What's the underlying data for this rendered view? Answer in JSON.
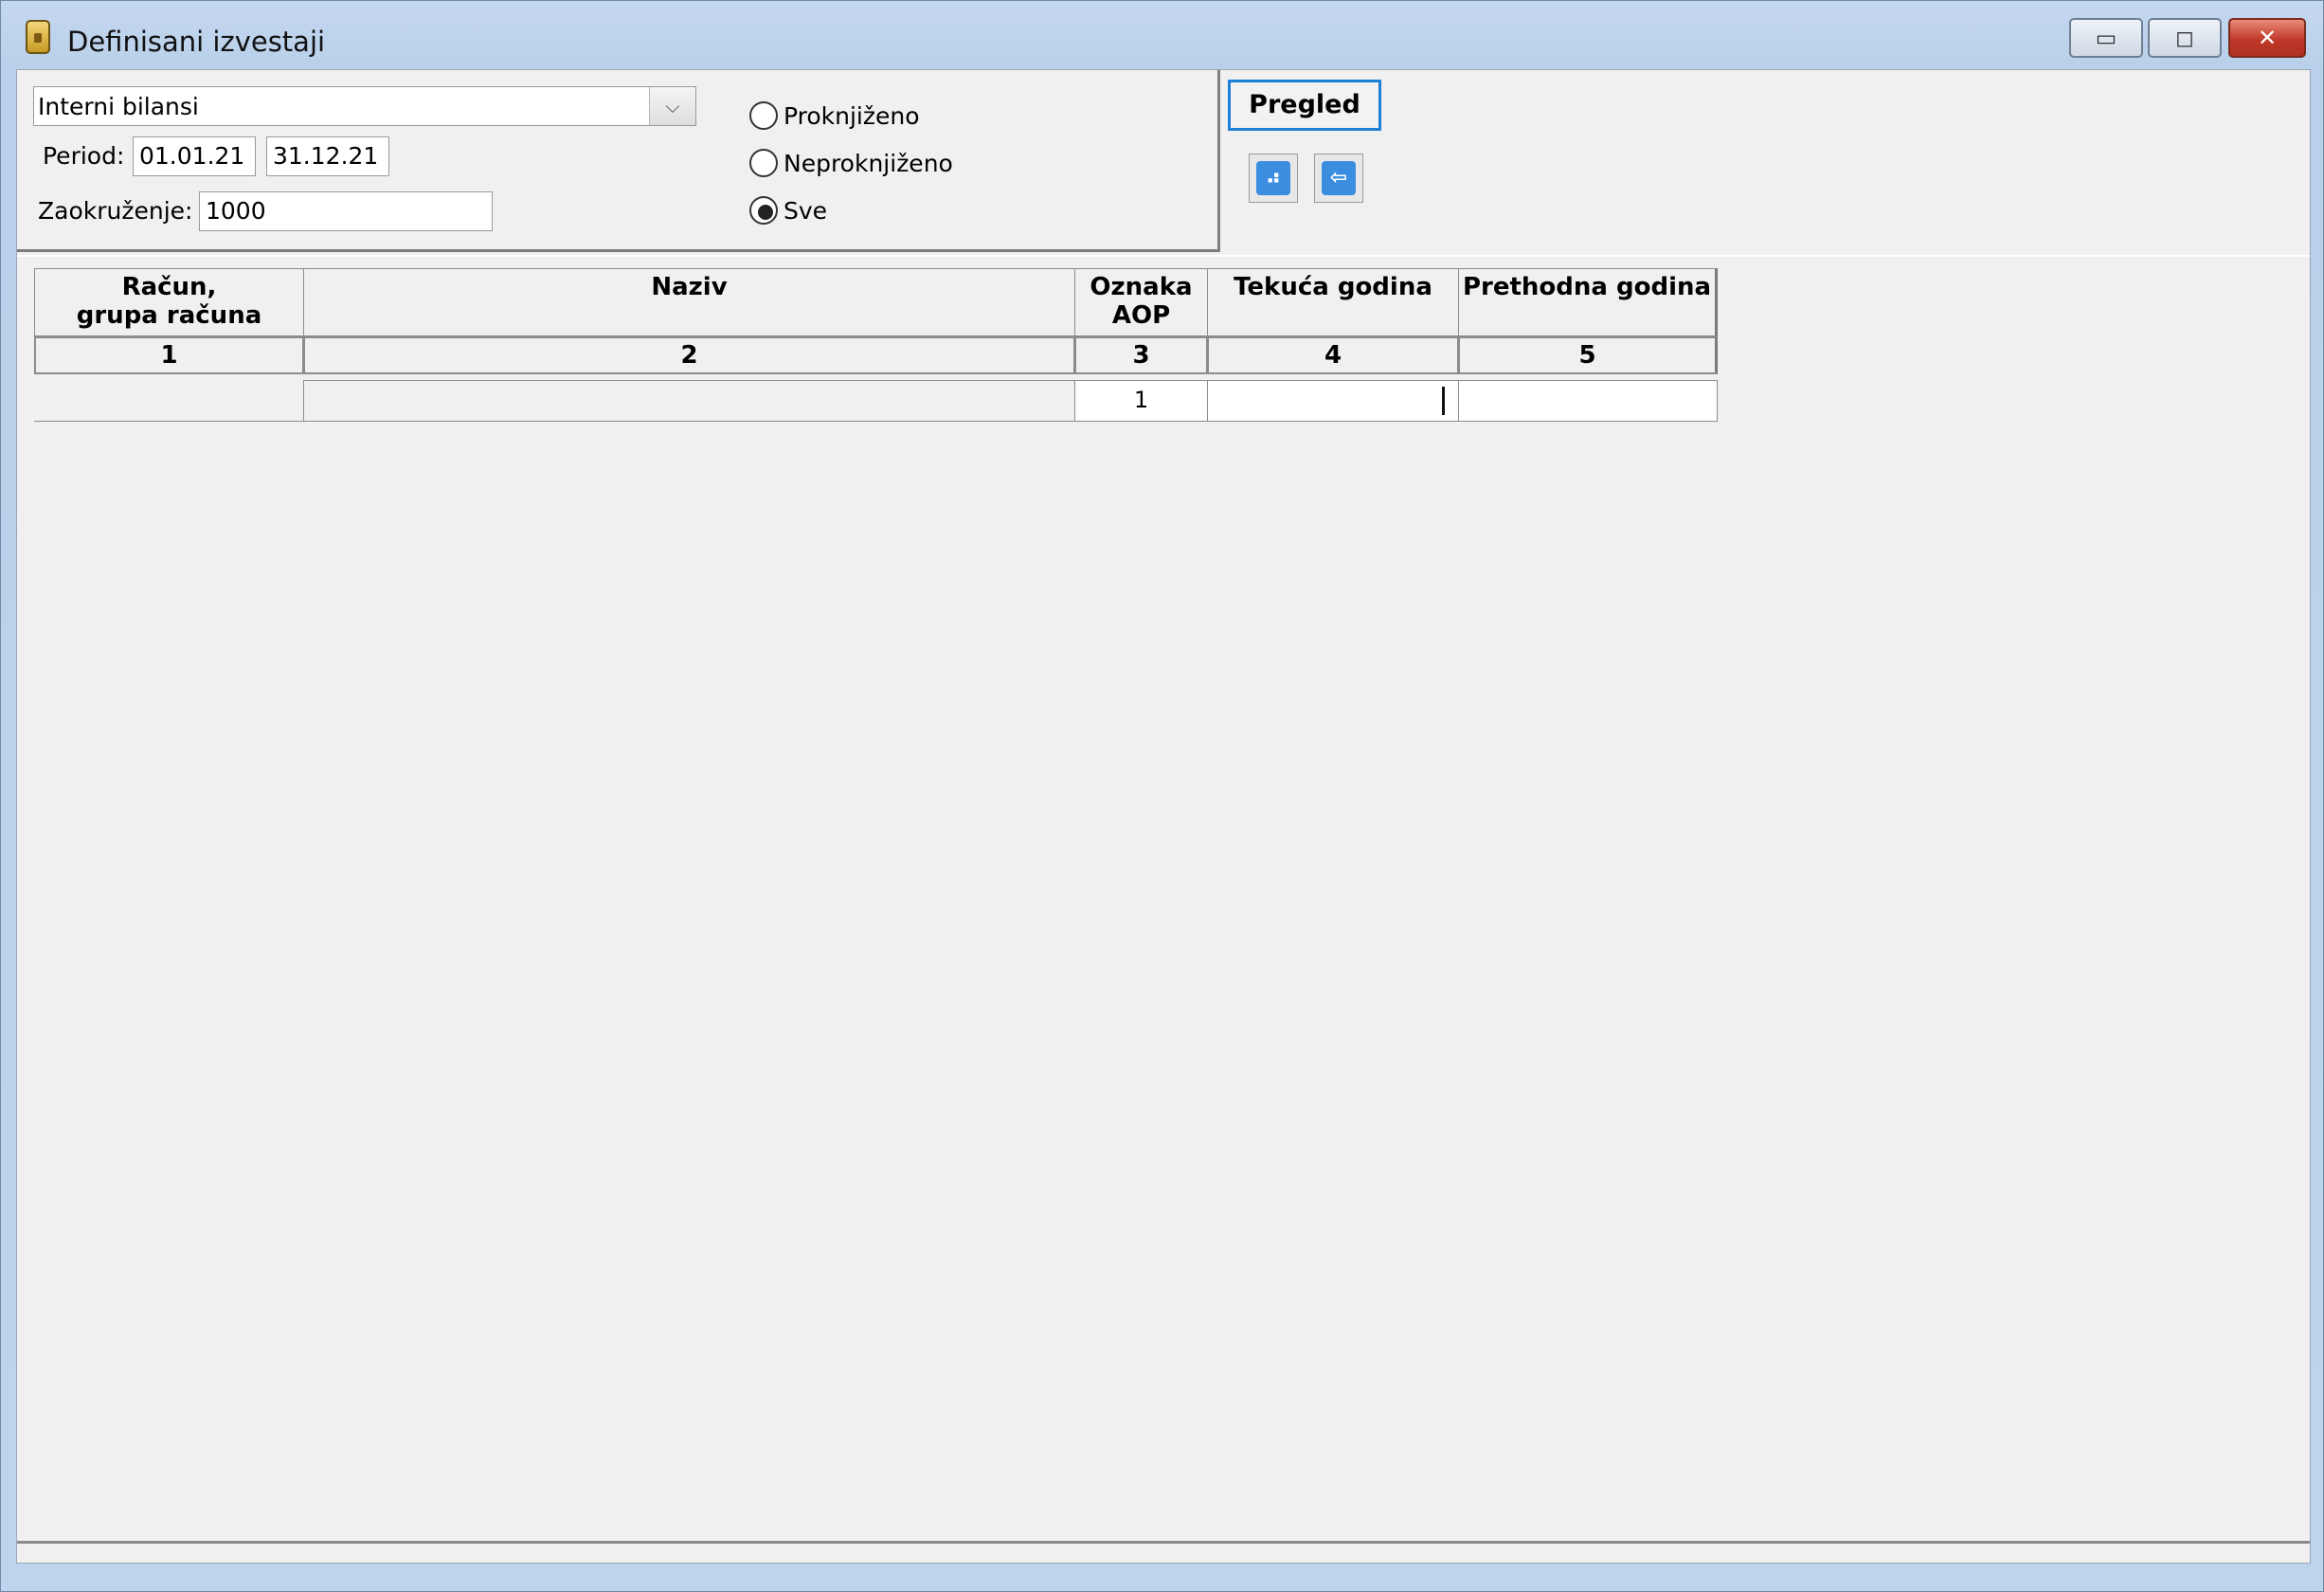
{
  "window": {
    "title": "Definisani izvestaji",
    "controls": {
      "minimize": "▭",
      "maximize": "◻",
      "close": "✕"
    }
  },
  "filters": {
    "report_select": {
      "value": "Interni bilansi",
      "arrow": "⌵"
    },
    "period_label": "Period:",
    "period_from": "01.01.21",
    "period_to": "31.12.21",
    "rounding_label": "Zaokruženje:",
    "rounding_value": "1000",
    "posting_options": [
      {
        "label": "Proknjiženo",
        "selected": false
      },
      {
        "label": "Neproknjiženo",
        "selected": false
      },
      {
        "label": "Sve",
        "selected": true
      }
    ]
  },
  "actions": {
    "preview_label": "Pregled",
    "icons": [
      "chart-icon",
      "exit-icon"
    ]
  },
  "table": {
    "headers": [
      {
        "line1": "Račun,",
        "line2": "grupa računa"
      },
      {
        "line1": "Naziv",
        "line2": ""
      },
      {
        "line1": "Oznaka",
        "line2": "AOP"
      },
      {
        "line1": "Tekuća godina",
        "line2": ""
      },
      {
        "line1": "Prethodna godina",
        "line2": ""
      }
    ],
    "column_numbers": [
      "1",
      "2",
      "3",
      "4",
      "5"
    ],
    "rows": [
      {
        "account": "",
        "name": "",
        "aop": "1",
        "current_year": "",
        "previous_year": ""
      }
    ]
  }
}
